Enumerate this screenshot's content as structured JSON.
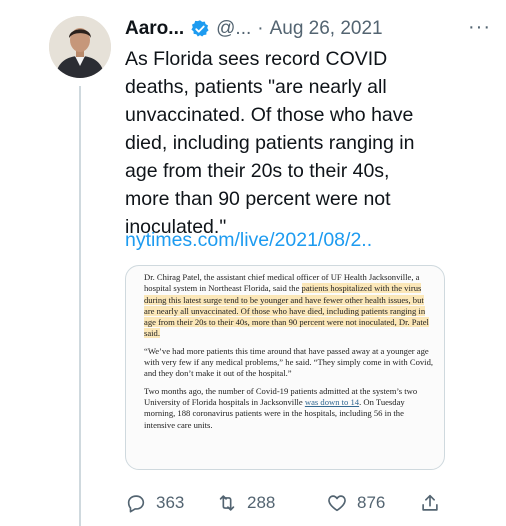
{
  "user": {
    "name": "Aaro...",
    "handle": "@...",
    "separator": "·",
    "date": "Aug 26, 2021",
    "more": "···"
  },
  "tweet": {
    "text": "As Florida sees record COVID deaths, patients \"are nearly all unvaccinated. Of those who have died, including patients ranging in age from their 20s to their 40s, more than 90 percent were not inoculated.\"",
    "link": "nytimes.com/live/2021/08/2.."
  },
  "article": {
    "p1_a": "Dr. Chirag Patel, the assistant chief medical officer of UF Health Jacksonville, a hospital system in Northeast Florida, said the ",
    "p1_b": "patients hospitalized with the virus during this latest surge tend to be younger and have fewer other health issues, but are nearly all unvaccinated. Of those who have died, including patients ranging in age from their 20s to their 40s, more than 90 percent were not inoculated, Dr. Patel said.",
    "p2": "“We’ve had more patients this time around that have passed away at a younger age with very few if any medical problems,” he said. “They simply come in with Covid, and they don’t make it out of the hospital.”",
    "p3_a": "Two months ago, the number of Covid-19 patients admitted at the system’s two University of Florida hospitals in Jacksonville ",
    "p3_link": "was down to 14",
    "p3_b": ". On Tuesday morning, 188 coronavirus patients were in the hospitals, including 56 in the intensive care units."
  },
  "actions": {
    "replies": "363",
    "retweets": "288",
    "likes": "876"
  },
  "colors": {
    "link": "#1d9bf0",
    "muted": "#536471",
    "highlight": "#fbe7b8"
  }
}
